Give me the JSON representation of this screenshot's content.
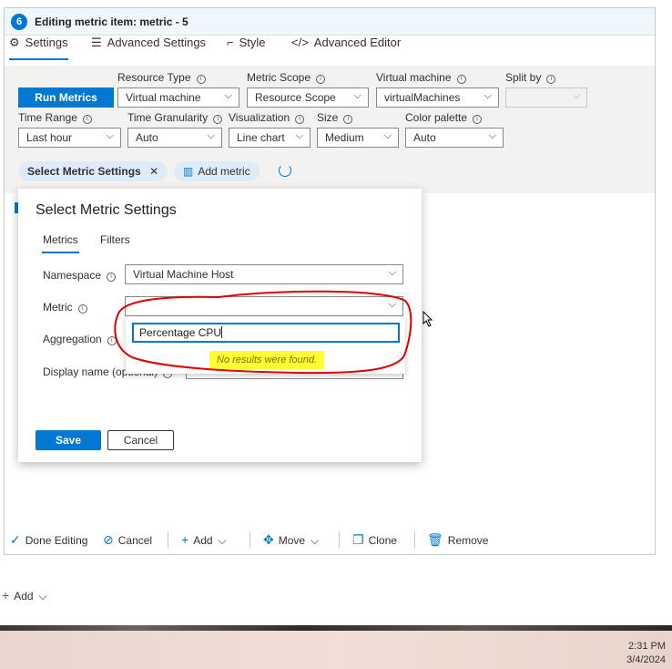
{
  "panel": {
    "step_number": "6",
    "title": "Editing metric item: metric - 5",
    "tabs": [
      "Settings",
      "Advanced Settings",
      "Style",
      "Advanced Editor"
    ]
  },
  "settings": {
    "run_metrics_label": "Run Metrics",
    "resource_type": {
      "label": "Resource Type",
      "value": "Virtual machine"
    },
    "metric_scope": {
      "label": "Metric Scope",
      "value": "Resource Scope"
    },
    "virtual_machine": {
      "label": "Virtual machine",
      "value": "virtualMachines"
    },
    "split_by": {
      "label": "Split by",
      "value": ""
    },
    "time_range": {
      "label": "Time Range",
      "value": "Last hour"
    },
    "time_granularity": {
      "label": "Time Granularity",
      "value": "Auto"
    },
    "visualization": {
      "label": "Visualization",
      "value": "Line chart"
    },
    "size": {
      "label": "Size",
      "value": "Medium"
    },
    "color_palette": {
      "label": "Color palette",
      "value": "Auto"
    },
    "chip_select_metric": "Select Metric Settings",
    "chip_add_metric": "Add metric"
  },
  "dialog": {
    "title": "Select Metric Settings",
    "tabs": [
      "Metrics",
      "Filters"
    ],
    "namespace": {
      "label": "Namespace",
      "value": "Virtual Machine Host"
    },
    "metric": {
      "label": "Metric",
      "value": ""
    },
    "aggregation": {
      "label": "Aggregation"
    },
    "display_name": {
      "label": "Display name (optional)"
    },
    "search_value": "Percentage CPU",
    "no_results": "No results were found.",
    "save_label": "Save",
    "cancel_label": "Cancel"
  },
  "toolbar": {
    "done_editing": "Done Editing",
    "cancel": "Cancel",
    "add": "Add",
    "move": "Move",
    "clone": "Clone",
    "remove": "Remove"
  },
  "below": {
    "add": "Add"
  },
  "taskbar": {
    "time": "2:31 PM",
    "date": "3/4/2024"
  },
  "colors": {
    "accent": "#0078d4",
    "highlight": "#ffff33",
    "annotation": "#e00000"
  }
}
